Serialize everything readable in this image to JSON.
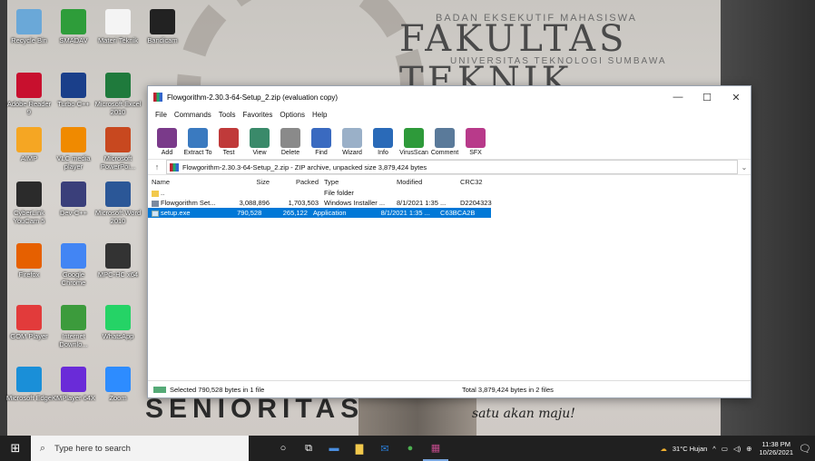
{
  "wallpaper": {
    "sign_small": "BADAN EKSEKUTIF MAHASISWA",
    "sign_big": "FAKULTAS TEKNIK",
    "sign_sub": "UNIVERSITAS TEKNOLOGI SUMBAWA",
    "banner": "SENIORITAS",
    "script_text": "satu akan maju!"
  },
  "desktop_icons": [
    {
      "label": "Recycle Bin",
      "icon": "recycle-bin-icon",
      "color": "#6aa8d8"
    },
    {
      "label": "SMADAV",
      "icon": "smadav-icon",
      "color": "#2e9d3a"
    },
    {
      "label": "Materi Teknik",
      "icon": "document-icon",
      "color": "#f4f4f4"
    },
    {
      "label": "Bandicam",
      "icon": "bandicam-icon",
      "color": "#222222"
    },
    {
      "label": "Adobe Reader 9",
      "icon": "adobe-reader-icon",
      "color": "#c8102e"
    },
    {
      "label": "Turbo C++",
      "icon": "turbo-cpp-icon",
      "color": "#1a3f8a"
    },
    {
      "label": "Microsoft Excel 2010",
      "icon": "excel-icon",
      "color": "#1f7a3c"
    },
    {
      "label": "AIMP",
      "icon": "aimp-icon",
      "color": "#f5a623"
    },
    {
      "label": "VLC media player",
      "icon": "vlc-icon",
      "color": "#f08a00"
    },
    {
      "label": "Microsoft PowerPoi...",
      "icon": "powerpoint-icon",
      "color": "#c8481f"
    },
    {
      "label": "CyberLink YouCam 5",
      "icon": "youcam-icon",
      "color": "#2b2b2b"
    },
    {
      "label": "Dev-C++",
      "icon": "devcpp-icon",
      "color": "#3a3f7a"
    },
    {
      "label": "Microsoft Word 2010",
      "icon": "word-icon",
      "color": "#2b5797"
    },
    {
      "label": "Firefox",
      "icon": "firefox-icon",
      "color": "#e66000"
    },
    {
      "label": "Google Chrome",
      "icon": "chrome-icon",
      "color": "#4285f4"
    },
    {
      "label": "MPC-HC x64",
      "icon": "mpc-hc-icon",
      "color": "#333333"
    },
    {
      "label": "GOM Player",
      "icon": "gom-player-icon",
      "color": "#e23b3b"
    },
    {
      "label": "Internet Downlo...",
      "icon": "idm-icon",
      "color": "#3c9b3c"
    },
    {
      "label": "WhatsApp",
      "icon": "whatsapp-icon",
      "color": "#25d366"
    },
    {
      "label": "Microsoft Edge",
      "icon": "edge-icon",
      "color": "#1a8fd8"
    },
    {
      "label": "KMPlayer 64X",
      "icon": "kmplayer-icon",
      "color": "#6a2bd8"
    },
    {
      "label": "Zoom",
      "icon": "zoom-icon",
      "color": "#2d8cff"
    }
  ],
  "window": {
    "title": "Flowgorithm-2.30.3-64-Setup_2.zip (evaluation copy)",
    "minimize": "—",
    "maximize": "☐",
    "close": "✕",
    "menu": [
      "File",
      "Commands",
      "Tools",
      "Favorites",
      "Options",
      "Help"
    ],
    "toolbar": [
      {
        "label": "Add",
        "icon": "add-icon",
        "color": "#7a3a8a"
      },
      {
        "label": "Extract To",
        "icon": "extract-icon",
        "color": "#3a7ac0"
      },
      {
        "label": "Test",
        "icon": "test-icon",
        "color": "#c03a3a"
      },
      {
        "label": "View",
        "icon": "view-icon",
        "color": "#3a8a6a"
      },
      {
        "label": "Delete",
        "icon": "delete-icon",
        "color": "#8a8a8a"
      },
      {
        "label": "Find",
        "icon": "find-icon",
        "color": "#3a6ac0"
      },
      {
        "label": "Wizard",
        "icon": "wizard-icon",
        "color": "#9ab0c8"
      },
      {
        "label": "Info",
        "icon": "info-icon",
        "color": "#2a6ab8"
      },
      {
        "label": "VirusScan",
        "icon": "virusscan-icon",
        "color": "#2e9a3a"
      },
      {
        "label": "Comment",
        "icon": "comment-icon",
        "color": "#5a7a9a"
      },
      {
        "label": "SFX",
        "icon": "sfx-icon",
        "color": "#b83a8a"
      }
    ],
    "address": "Flowgorithm-2.30.3-64-Setup_2.zip - ZIP archive, unpacked size 3,879,424 bytes",
    "columns": {
      "name": "Name",
      "size": "Size",
      "packed": "Packed",
      "type": "Type",
      "modified": "Modified",
      "crc": "CRC32"
    },
    "rows": [
      {
        "name": "..",
        "size": "",
        "packed": "",
        "type": "File folder",
        "modified": "",
        "crc": "",
        "icon": "folder"
      },
      {
        "name": "Flowgorithm Set...",
        "size": "3,088,896",
        "packed": "1,703,503",
        "type": "Windows Installer ...",
        "modified": "8/1/2021 1:35 ...",
        "crc": "D2204323",
        "icon": "msi"
      },
      {
        "name": "setup.exe",
        "size": "790,528",
        "packed": "265,122",
        "type": "Application",
        "modified": "8/1/2021 1:35 ...",
        "crc": "C63BCA2B",
        "icon": "exe"
      }
    ],
    "status_left": "Selected 790,528 bytes in 1 file",
    "status_right": "Total 3,879,424 bytes in 2 files"
  },
  "taskbar": {
    "search_placeholder": "Type here to search",
    "weather": "31°C Hujan",
    "time": "11:38 PM",
    "date": "10/26/2021"
  }
}
